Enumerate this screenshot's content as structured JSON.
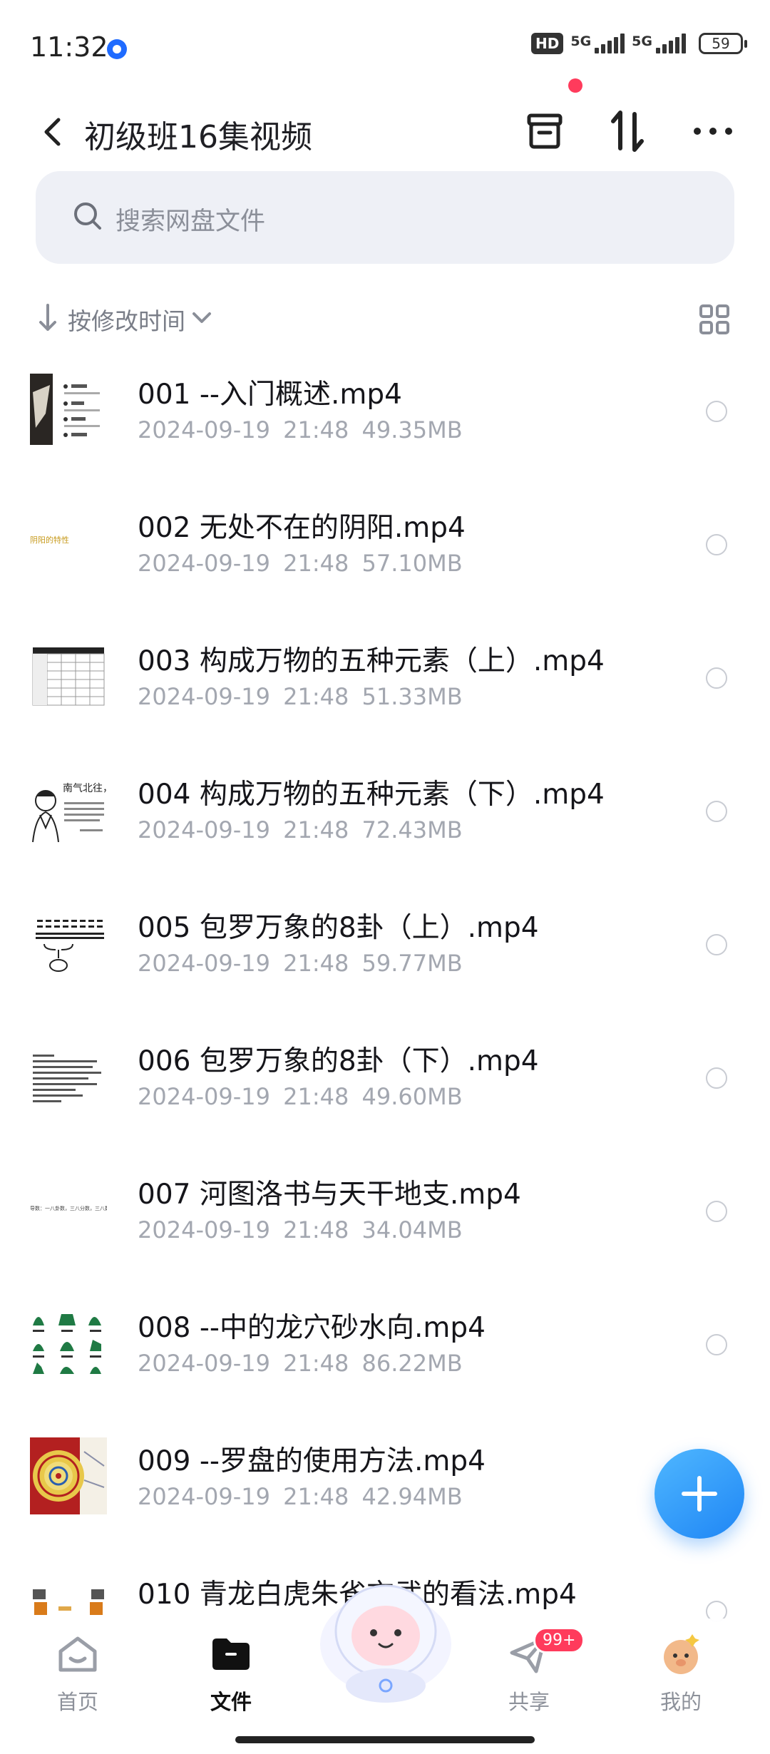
{
  "status_bar": {
    "time": "11:32",
    "hd": "HD",
    "sim1": "5G",
    "sim2": "5G",
    "battery": "59"
  },
  "header": {
    "title": "初级班16集视频"
  },
  "search": {
    "placeholder": "搜索网盘文件"
  },
  "sort": {
    "label": "按修改时间"
  },
  "files": [
    {
      "name": "001 --入门概述.mp4",
      "date": "2024-09-19",
      "time": "21:48",
      "size": "49.35MB"
    },
    {
      "name": "002 无处不在的阴阳.mp4",
      "date": "2024-09-19",
      "time": "21:48",
      "size": "57.10MB"
    },
    {
      "name": "003 构成万物的五种元素（上）.mp4",
      "date": "2024-09-19",
      "time": "21:48",
      "size": "51.33MB"
    },
    {
      "name": "004 构成万物的五种元素（下）.mp4",
      "date": "2024-09-19",
      "time": "21:48",
      "size": "72.43MB"
    },
    {
      "name": "005 包罗万象的8卦（上）.mp4",
      "date": "2024-09-19",
      "time": "21:48",
      "size": "59.77MB"
    },
    {
      "name": "006 包罗万象的8卦（下）.mp4",
      "date": "2024-09-19",
      "time": "21:48",
      "size": "49.60MB"
    },
    {
      "name": "007 河图洛书与天干地支.mp4",
      "date": "2024-09-19",
      "time": "21:48",
      "size": "34.04MB"
    },
    {
      "name": "008 --中的龙穴砂水向.mp4",
      "date": "2024-09-19",
      "time": "21:48",
      "size": "86.22MB"
    },
    {
      "name": "009 --罗盘的使用方法.mp4",
      "date": "2024-09-19",
      "time": "21:48",
      "size": "42.94MB"
    },
    {
      "name": "010 青龙白虎朱雀玄武的看法.mp4",
      "date": "",
      "time": "",
      "size": ""
    }
  ],
  "thumb_texts": {
    "t2": "阴阳的特性",
    "t4": "南气北往，天",
    "t7": "导数：一八卦数，三八分数，三八数数"
  },
  "nav": {
    "home": "首页",
    "files": "文件",
    "share": "共享",
    "share_badge": "99+",
    "mine": "我的"
  }
}
